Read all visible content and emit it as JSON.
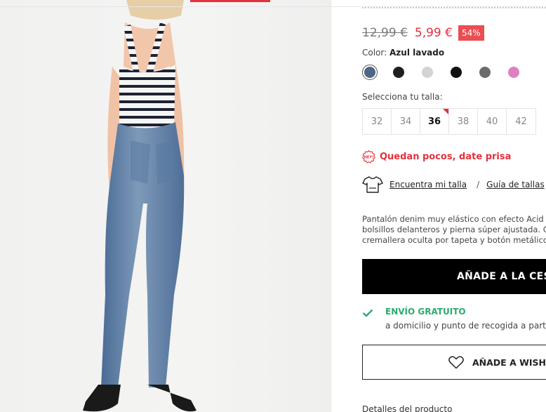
{
  "price": {
    "old": "12,99 €",
    "new": "5,99 €",
    "discount": "54%"
  },
  "color": {
    "label": "Color:",
    "selected_name": "Azul lavado"
  },
  "swatches": [
    {
      "name": "azul lavado",
      "color": "#4e6585",
      "selected": true
    },
    {
      "name": "negro",
      "color": "#1f1f1f"
    },
    {
      "name": "gris claro",
      "color": "#d5d2d4"
    },
    {
      "name": "negro 2",
      "color": "#121212"
    },
    {
      "name": "gris",
      "color": "#6c6c6c"
    },
    {
      "name": "rosa",
      "color": "#e07fc0"
    }
  ],
  "size": {
    "label": "Selecciona tu talla:",
    "options": [
      "32",
      "34",
      "36",
      "38",
      "40",
      "42"
    ],
    "selected": "36"
  },
  "stock": {
    "badge": "HEY!",
    "text": "Quedan pocos, date prisa"
  },
  "size_guide": {
    "find": "Encuentra mi talla",
    "separator": "/",
    "guide": "Guía de tallas"
  },
  "description": [
    "Pantalón denim muy elástico con efecto Acid W",
    "bolsillos delanteros y pierna súper ajustada. C",
    "cremallera oculta por tapeta y botón metálico"
  ],
  "add_to_cart": "AÑADE A LA CEST",
  "shipping": {
    "title": "ENVÍO GRATUITO",
    "subtitle": "a domicilio y punto de recogida a part"
  },
  "wishlist": "AÑADE A WISHLIS",
  "details": "Detalles del producto",
  "colors": {
    "accent_red": "#e2323c",
    "discount_bg": "#e94e53",
    "success_green": "#2daa6e"
  }
}
